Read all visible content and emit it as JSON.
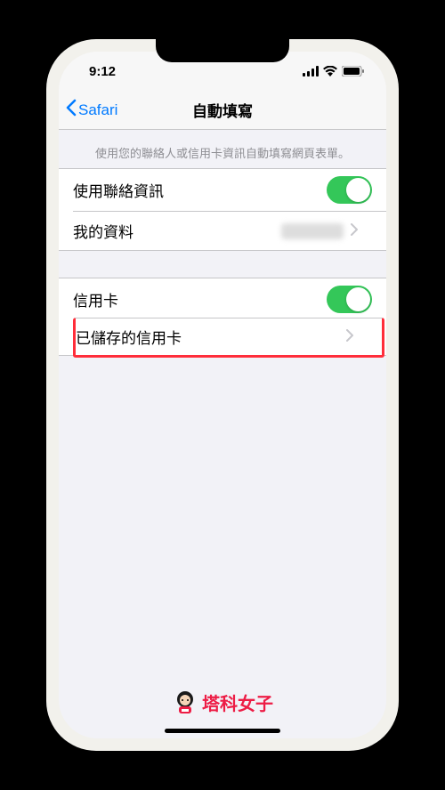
{
  "status": {
    "time": "9:12"
  },
  "nav": {
    "back_label": "Safari",
    "title": "自動填寫"
  },
  "header": {
    "description": "使用您的聯絡人或信用卡資訊自動填寫網頁表單。"
  },
  "section1": {
    "contact_info_label": "使用聯絡資訊",
    "contact_info_on": true,
    "my_info_label": "我的資料"
  },
  "section2": {
    "credit_card_label": "信用卡",
    "credit_card_on": true,
    "saved_cards_label": "已儲存的信用卡"
  },
  "watermark": {
    "text": "塔科女子"
  },
  "colors": {
    "link": "#007aff",
    "toggle_on": "#34c759",
    "highlight": "#ff2d3a",
    "brand": "#ed1c45"
  }
}
